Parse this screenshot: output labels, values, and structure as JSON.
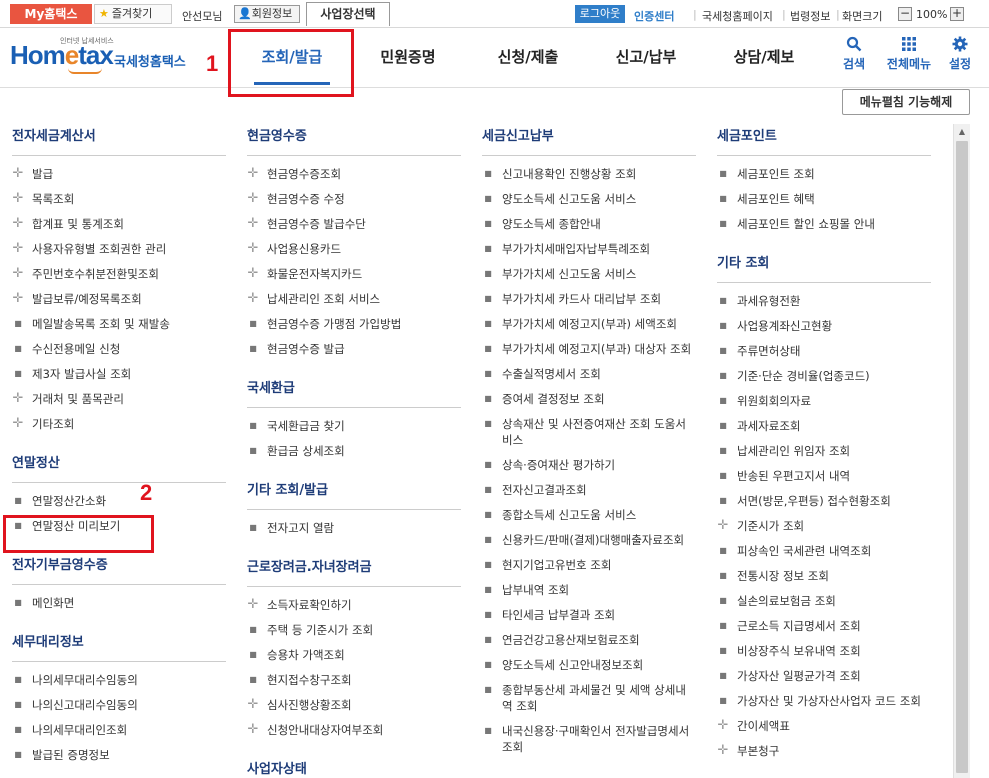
{
  "topbar": {
    "my_home": "My홈택스",
    "favorites": "즐겨찾기",
    "user": "안선모님",
    "member_info": "회원정보",
    "business_select": "사업장선택",
    "logout": "로그아웃",
    "cert_center": "인증센터",
    "nts_page": "국세청홈페이지",
    "law_info": "법령정보",
    "screen_size": "화면크기",
    "zoom_minus": "−",
    "zoom_value": "100%",
    "zoom_plus": "+"
  },
  "logo": {
    "tagline": "인터넷 납세서비스",
    "home": "Hom",
    "e": "e",
    "tax": "tax",
    "korean": "국세청홈택스"
  },
  "nav": {
    "items": [
      "조회/발급",
      "민원증명",
      "신청/제출",
      "신고/납부",
      "상담/제보"
    ],
    "active_index": 0
  },
  "tools": {
    "search": "검색",
    "all_menu": "전체메뉴",
    "settings": "설정"
  },
  "annotations": {
    "n1": "1",
    "n2": "2"
  },
  "collapse_button": "메뉴펼침 기능해제",
  "colors": {
    "accent": "#2565b8",
    "highlight": "#e0141e",
    "section": "#1e3c78"
  },
  "columns": [
    {
      "sections": [
        {
          "title": "전자세금계산서",
          "items": [
            {
              "t": "발급",
              "b": "plus"
            },
            {
              "t": "목록조회",
              "b": "plus"
            },
            {
              "t": "합계표 및 통계조회",
              "b": "plus"
            },
            {
              "t": "사용자유형별 조회권한 관리",
              "b": "plus"
            },
            {
              "t": "주민번호수취분전환및조회",
              "b": "plus"
            },
            {
              "t": "발급보류/예정목록조회",
              "b": "plus"
            },
            {
              "t": "메일발송목록 조회 및 재발송",
              "b": "dot"
            },
            {
              "t": "수신전용메일 신청",
              "b": "dot"
            },
            {
              "t": "제3자 발급사실 조회",
              "b": "dot"
            },
            {
              "t": "거래처 및 품목관리",
              "b": "plus"
            },
            {
              "t": "기타조회",
              "b": "plus"
            }
          ]
        },
        {
          "title": "연말정산",
          "items": [
            {
              "t": "연말정산간소화",
              "b": "dot"
            },
            {
              "t": "연말정산 미리보기",
              "b": "dot"
            }
          ]
        },
        {
          "title": "전자기부금영수증",
          "items": [
            {
              "t": "메인화면",
              "b": "dot"
            }
          ]
        },
        {
          "title": "세무대리정보",
          "items": [
            {
              "t": "나의세무대리수임동의",
              "b": "dot"
            },
            {
              "t": "나의신고대리수임동의",
              "b": "dot"
            },
            {
              "t": "나의세무대리인조회",
              "b": "dot"
            },
            {
              "t": "발급된 증명정보",
              "b": "dot"
            }
          ]
        }
      ]
    },
    {
      "sections": [
        {
          "title": "현금영수증",
          "items": [
            {
              "t": "현금영수증조회",
              "b": "plus"
            },
            {
              "t": "현금영수증 수정",
              "b": "plus"
            },
            {
              "t": "현금영수증 발급수단",
              "b": "plus"
            },
            {
              "t": "사업용신용카드",
              "b": "plus"
            },
            {
              "t": "화물운전자복지카드",
              "b": "plus"
            },
            {
              "t": "납세관리인 조회 서비스",
              "b": "plus"
            },
            {
              "t": "현금영수증 가맹점 가입방법",
              "b": "dot"
            },
            {
              "t": "현금영수증 발급",
              "b": "dot"
            }
          ]
        },
        {
          "title": "국세환급",
          "items": [
            {
              "t": "국세환급금 찾기",
              "b": "dot"
            },
            {
              "t": "환급금 상세조회",
              "b": "dot"
            }
          ]
        },
        {
          "title": "기타 조회/발급",
          "items": [
            {
              "t": "전자고지 열람",
              "b": "dot"
            }
          ]
        },
        {
          "title": "근로장려금.자녀장려금",
          "items": [
            {
              "t": "소득자료확인하기",
              "b": "plus"
            },
            {
              "t": "주택 등 기준시가 조회",
              "b": "dot"
            },
            {
              "t": "승용차 가액조회",
              "b": "dot"
            },
            {
              "t": "현지접수창구조회",
              "b": "dot"
            },
            {
              "t": "심사진행상황조회",
              "b": "plus"
            },
            {
              "t": "신청안내대상자여부조회",
              "b": "plus"
            }
          ]
        },
        {
          "title": "사업자상태",
          "items": []
        }
      ]
    },
    {
      "sections": [
        {
          "title": "세금신고납부",
          "items": [
            {
              "t": "신고내용확인 진행상황 조회",
              "b": "dot"
            },
            {
              "t": "양도소득세 신고도움 서비스",
              "b": "dot"
            },
            {
              "t": "양도소득세 종합안내",
              "b": "dot"
            },
            {
              "t": "부가가치세매입자납부특례조회",
              "b": "dot"
            },
            {
              "t": "부가가치세 신고도움 서비스",
              "b": "dot"
            },
            {
              "t": "부가가치세 카드사 대리납부 조회",
              "b": "dot"
            },
            {
              "t": "부가가치세 예정고지(부과) 세액조회",
              "b": "dot"
            },
            {
              "t": "부가가치세 예정고지(부과) 대상자 조회",
              "b": "dot"
            },
            {
              "t": "수출실적명세서 조회",
              "b": "dot"
            },
            {
              "t": "증여세 결정정보 조회",
              "b": "dot"
            },
            {
              "t": "상속재산 및 사전증여재산 조회 도움서비스",
              "b": "dot"
            },
            {
              "t": "상속·증여재산 평가하기",
              "b": "dot"
            },
            {
              "t": "전자신고결과조회",
              "b": "dot"
            },
            {
              "t": "종합소득세 신고도움 서비스",
              "b": "dot"
            },
            {
              "t": "신용카드/판매(결제)대행매출자료조회",
              "b": "dot"
            },
            {
              "t": "현지기업고유번호 조회",
              "b": "dot"
            },
            {
              "t": "납부내역 조회",
              "b": "dot"
            },
            {
              "t": "타인세금 납부결과 조회",
              "b": "dot"
            },
            {
              "t": "연금건강고용산재보험료조회",
              "b": "dot"
            },
            {
              "t": "양도소득세 신고안내정보조회",
              "b": "dot"
            },
            {
              "t": "종합부동산세 과세물건 및 세액 상세내역 조회",
              "b": "dot"
            },
            {
              "t": "내국신용장·구매확인서 전자발급명세서 조회",
              "b": "dot"
            }
          ]
        }
      ]
    },
    {
      "sections": [
        {
          "title": "세금포인트",
          "items": [
            {
              "t": "세금포인트 조회",
              "b": "dot"
            },
            {
              "t": "세금포인트 혜택",
              "b": "dot"
            },
            {
              "t": "세금포인트 할인 쇼핑몰 안내",
              "b": "dot"
            }
          ]
        },
        {
          "title": "기타 조회",
          "items": [
            {
              "t": "과세유형전환",
              "b": "dot"
            },
            {
              "t": "사업용계좌신고현황",
              "b": "dot"
            },
            {
              "t": "주류면허상태",
              "b": "dot"
            },
            {
              "t": "기준·단순 경비율(업종코드)",
              "b": "dot"
            },
            {
              "t": "위원회회의자료",
              "b": "dot"
            },
            {
              "t": "과세자료조회",
              "b": "dot"
            },
            {
              "t": "납세관리인 위임자 조회",
              "b": "dot"
            },
            {
              "t": "반송된 우편고지서 내역",
              "b": "dot"
            },
            {
              "t": "서면(방문,우편등) 접수현황조회",
              "b": "dot"
            },
            {
              "t": "기준시가 조회",
              "b": "plus"
            },
            {
              "t": "피상속인 국세관련 내역조회",
              "b": "dot"
            },
            {
              "t": "전통시장 정보 조회",
              "b": "dot"
            },
            {
              "t": "실손의료보험금 조회",
              "b": "dot"
            },
            {
              "t": "근로소득 지급명세서 조회",
              "b": "dot"
            },
            {
              "t": "비상장주식 보유내역 조회",
              "b": "dot"
            },
            {
              "t": "가상자산 일평균가격 조회",
              "b": "dot"
            },
            {
              "t": "가상자산 및 가상자산사업자 코드 조회",
              "b": "dot"
            },
            {
              "t": "간이세액표",
              "b": "plus"
            },
            {
              "t": "부본청구",
              "b": "plus"
            }
          ]
        }
      ]
    }
  ]
}
